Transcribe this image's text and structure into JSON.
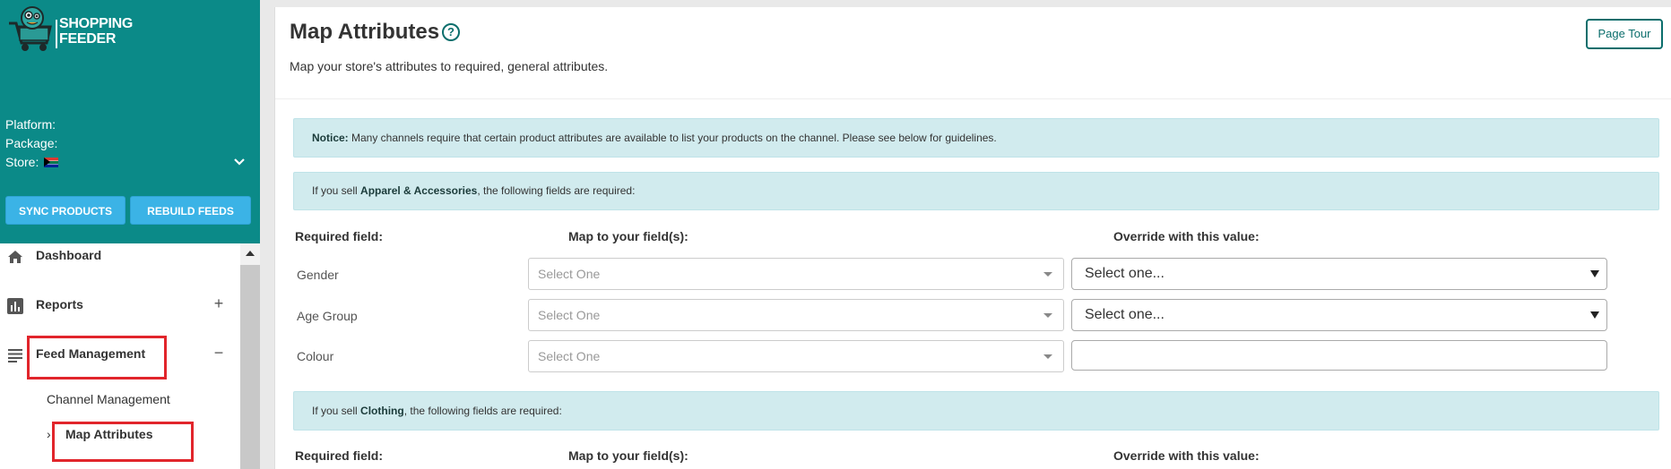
{
  "brand": {
    "line1": "SHOPPING",
    "line2": "FEEDER"
  },
  "sidebar": {
    "platform_label": "Platform:",
    "package_label": "Package:",
    "store_label": "Store:",
    "sync_button": "SYNC PRODUCTS",
    "rebuild_button": "REBUILD FEEDS",
    "nav": [
      {
        "label": "Dashboard",
        "icon": "home-icon"
      },
      {
        "label": "Reports",
        "icon": "bar-chart-icon",
        "toggle": "+"
      },
      {
        "label": "Feed Management",
        "icon": "list-icon",
        "toggle": "−"
      }
    ],
    "sub_items": [
      "Channel Management",
      "Map Attributes"
    ],
    "active_arrow": "›"
  },
  "page": {
    "title": "Map Attributes",
    "help": "?",
    "subtitle": "Map your store's attributes to required, general attributes.",
    "tour_button": "Page Tour"
  },
  "notice": {
    "lead": "Notice:",
    "text": " Many channels require that certain product attributes are available to list your products on the channel. Please see below for guidelines."
  },
  "sections": [
    {
      "prefix": "If you sell ",
      "category": "Apparel & Accessories",
      "suffix": ", the following fields are required:",
      "headers": {
        "required": "Required field:",
        "map": "Map to your field(s):",
        "override": "Override with this value:"
      },
      "rows": [
        {
          "label": "Gender",
          "map_placeholder": "Select One",
          "override_value": "Select one..."
        },
        {
          "label": "Age Group",
          "map_placeholder": "Select One",
          "override_value": "Select one..."
        },
        {
          "label": "Colour",
          "map_placeholder": "Select One",
          "override_value": ""
        }
      ]
    },
    {
      "prefix": "If you sell ",
      "category": "Clothing",
      "suffix": ", the following fields are required:",
      "headers": {
        "required": "Required field:",
        "map": "Map to your field(s):",
        "override": "Override with this value:"
      }
    }
  ],
  "colors": {
    "sidebar": "#0b8a88",
    "accent_button": "#3bb3e6",
    "highlight": "#e1252b",
    "notice_bg": "#d1ebee"
  }
}
